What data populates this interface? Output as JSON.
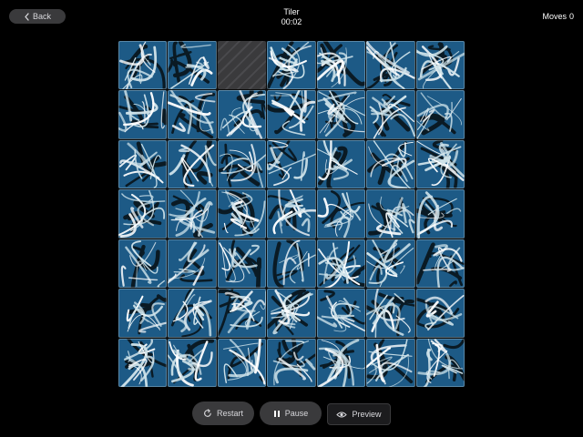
{
  "header": {
    "back_label": "Back",
    "title": "Tiler",
    "timer": "00:02",
    "moves_label": "Moves",
    "moves_count": "0"
  },
  "board": {
    "rows": 7,
    "cols": 7,
    "empty_slot": {
      "row": 0,
      "col": 2
    },
    "image_subject": "ice-covered tree branches against blue sky"
  },
  "controls": {
    "restart_label": "Restart",
    "pause_label": "Pause",
    "preview_label": "Preview"
  },
  "icons": {
    "back": "chevron-left-icon",
    "restart": "restart-icon",
    "pause": "pause-icon",
    "preview": "eye-icon"
  },
  "colors": {
    "background": "#000000",
    "button": "#3a3a3c",
    "sky": "#1d5a86",
    "ice": "#cfe3ea"
  }
}
